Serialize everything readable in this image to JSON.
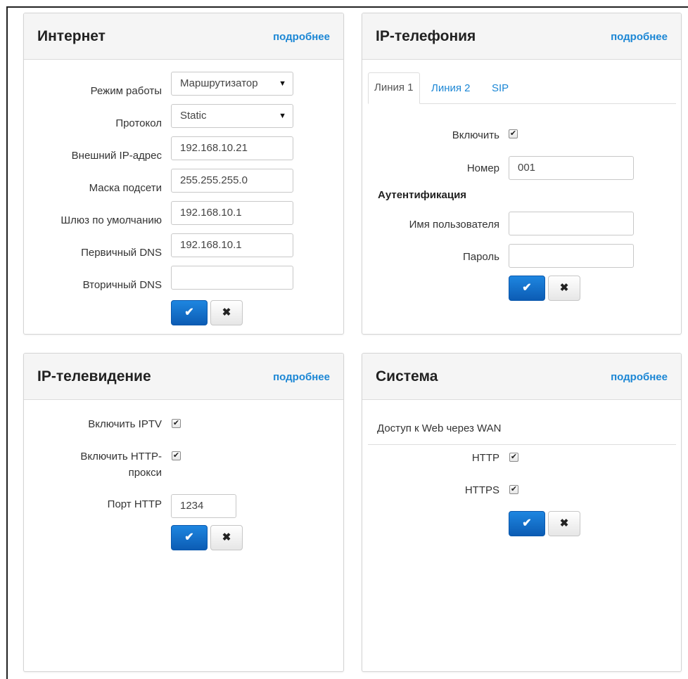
{
  "internet": {
    "title": "Интернет",
    "more": "подробнее",
    "mode_label": "Режим работы",
    "mode_value": "Маршрутизатор",
    "protocol_label": "Протокол",
    "protocol_value": "Static",
    "ext_ip_label": "Внешний IP-адрес",
    "ext_ip_value": "192.168.10.21",
    "mask_label": "Маска подсети",
    "mask_value": "255.255.255.0",
    "gateway_label": "Шлюз по умолчанию",
    "gateway_value": "192.168.10.1",
    "dns1_label": "Первичный DNS",
    "dns1_value": "192.168.10.1",
    "dns2_label": "Вторичный DNS",
    "dns2_value": ""
  },
  "ip_phone": {
    "title": "IP-телефония",
    "more": "подробнее",
    "tabs": [
      "Линия 1",
      "Линия 2",
      "SIP"
    ],
    "enable_label": "Включить",
    "enable_checked": true,
    "number_label": "Номер",
    "number_value": "001",
    "auth_title": "Аутентификация",
    "user_label": "Имя пользователя",
    "user_value": "",
    "pass_label": "Пароль",
    "pass_value": ""
  },
  "iptv": {
    "title": "IP-телевидение",
    "more": "подробнее",
    "enable_iptv_label": "Включить IPTV",
    "enable_iptv_checked": true,
    "enable_proxy_label_1": "Включить HTTP-",
    "enable_proxy_label_2": "прокси",
    "enable_proxy_checked": true,
    "port_label": "Порт HTTP",
    "port_value": "1234"
  },
  "system": {
    "title": "Система",
    "more": "подробнее",
    "web_access_title": "Доступ к Web через WAN",
    "http_label": "HTTP",
    "http_checked": true,
    "https_label": "HTTPS",
    "https_checked": true
  },
  "buttons": {
    "ok_glyph": "✔",
    "cancel_glyph": "✖",
    "check_glyph": "✔",
    "caret_glyph": "▼"
  },
  "colors": {
    "link": "#1c87d5",
    "primary_button": "#0c5cb4"
  }
}
